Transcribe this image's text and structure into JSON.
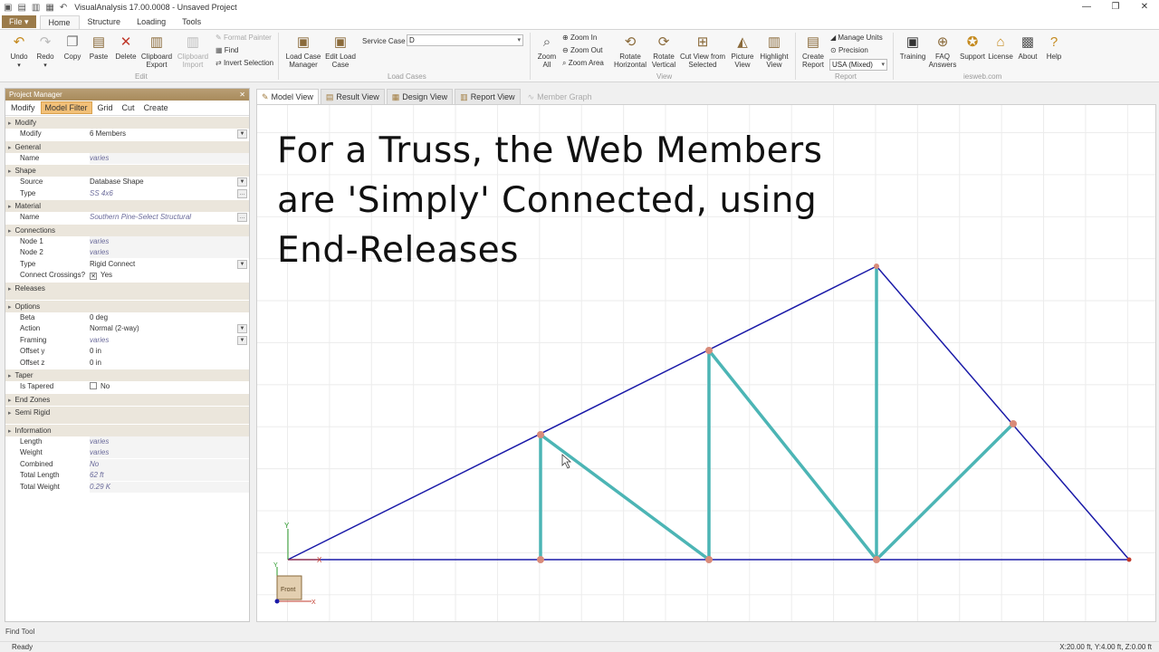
{
  "window": {
    "title": "VisualAnalysis 17.00.0008 - Unsaved Project",
    "controls": [
      "—",
      "❐",
      "✕"
    ]
  },
  "ribbon_tabs": {
    "file": "File ▾",
    "tabs": [
      "Home",
      "Structure",
      "Loading",
      "Tools"
    ]
  },
  "ribbon": {
    "edit": {
      "undo": "Undo",
      "redo": "Redo",
      "copy": "Copy",
      "paste": "Paste",
      "delete": "Delete",
      "clipboard_export_1": "Clipboard",
      "clipboard_export_2": "Export",
      "clipboard_import_1": "Clipboard",
      "clipboard_import_2": "Import",
      "format_painter": "Format Painter",
      "find": "Find",
      "invert_selection": "Invert Selection",
      "group": "Edit"
    },
    "load_cases": {
      "lcm_1": "Load Case",
      "lcm_2": "Manager",
      "elc_1": "Edit Load",
      "elc_2": "Case",
      "service_case_label": "Service Case",
      "service_case_value": "D",
      "group": "Load Cases"
    },
    "view": {
      "zoom_all_1": "Zoom",
      "zoom_all_2": "All",
      "zoom_in": "Zoom In",
      "zoom_out": "Zoom Out",
      "zoom_area": "Zoom Area",
      "rot_h_1": "Rotate",
      "rot_h_2": "Horizontal",
      "rot_v_1": "Rotate",
      "rot_v_2": "Vertical",
      "cut_1": "Cut View from",
      "cut_2": "Selected",
      "pic_1": "Picture",
      "pic_2": "View",
      "hl_1": "Highlight",
      "hl_2": "View",
      "group": "View"
    },
    "report": {
      "cr_1": "Create",
      "cr_2": "Report",
      "manage_units": "Manage Units",
      "precision": "Precision",
      "units_value": "USA (Mixed)",
      "group": "Report"
    },
    "iesweb": {
      "training": "Training",
      "faq_1": "FAQ",
      "faq_2": "Answers",
      "support": "Support",
      "license": "License",
      "about": "About",
      "help": "Help",
      "group": "iesweb.com"
    }
  },
  "project_manager": {
    "title": "Project Manager",
    "close": "✕",
    "tabs": [
      "Modify",
      "Model Filter",
      "Grid",
      "Cut",
      "Create"
    ],
    "sections": {
      "modify": "Modify",
      "general": "General",
      "shape": "Shape",
      "material": "Material",
      "connections": "Connections",
      "releases": "Releases",
      "options": "Options",
      "taper": "Taper",
      "end_zones": "End Zones",
      "semi_rigid": "Semi Rigid",
      "information": "Information"
    },
    "props": {
      "modify_k": "Modify",
      "modify_v": "6 Members",
      "name_k": "Name",
      "name_v": "varies",
      "source_k": "Source",
      "source_v": "Database Shape",
      "type_k": "Type",
      "type_v": "SS 4x6",
      "mat_name_k": "Name",
      "mat_name_v": "Southern Pine-Select Structural",
      "node1_k": "Node 1",
      "node1_v": "varies",
      "node2_k": "Node 2",
      "node2_v": "varies",
      "ctype_k": "Type",
      "ctype_v": "Rigid Connect",
      "cross_k": "Connect Crossings?",
      "cross_v": "Yes",
      "beta_k": "Beta",
      "beta_v": "0 deg",
      "action_k": "Action",
      "action_v": "Normal (2-way)",
      "framing_k": "Framing",
      "framing_v": "varies",
      "offy_k": "Offset y",
      "offy_v": "0 in",
      "offz_k": "Offset z",
      "offz_v": "0 in",
      "tapered_k": "Is Tapered",
      "tapered_v": "No",
      "length_k": "Length",
      "length_v": "varies",
      "weight_k": "Weight",
      "weight_v": "varies",
      "combined_k": "Combined",
      "combined_v": "No",
      "tlength_k": "Total Length",
      "tlength_v": "62 ft",
      "tweight_k": "Total Weight",
      "tweight_v": "0.29 K"
    }
  },
  "view_tabs": [
    "Model View",
    "Result View",
    "Design View",
    "Report View",
    "Member Graph"
  ],
  "overlay_text": {
    "line1": "For a Truss, the Web Members",
    "line2": "are 'Simply' Connected, using",
    "line3": "End-Releases"
  },
  "axes": {
    "y": "Y",
    "x": "X",
    "front": "Front"
  },
  "status": {
    "find_tool": "Find Tool",
    "ready": "Ready",
    "coords": "X:20.00 ft, Y:4.00 ft, Z:0.00 ft"
  },
  "colors": {
    "chord": "#1a1aa8",
    "web": "#4cb5b5",
    "node": "#d98b7a",
    "accent": "#9b7b4a"
  }
}
